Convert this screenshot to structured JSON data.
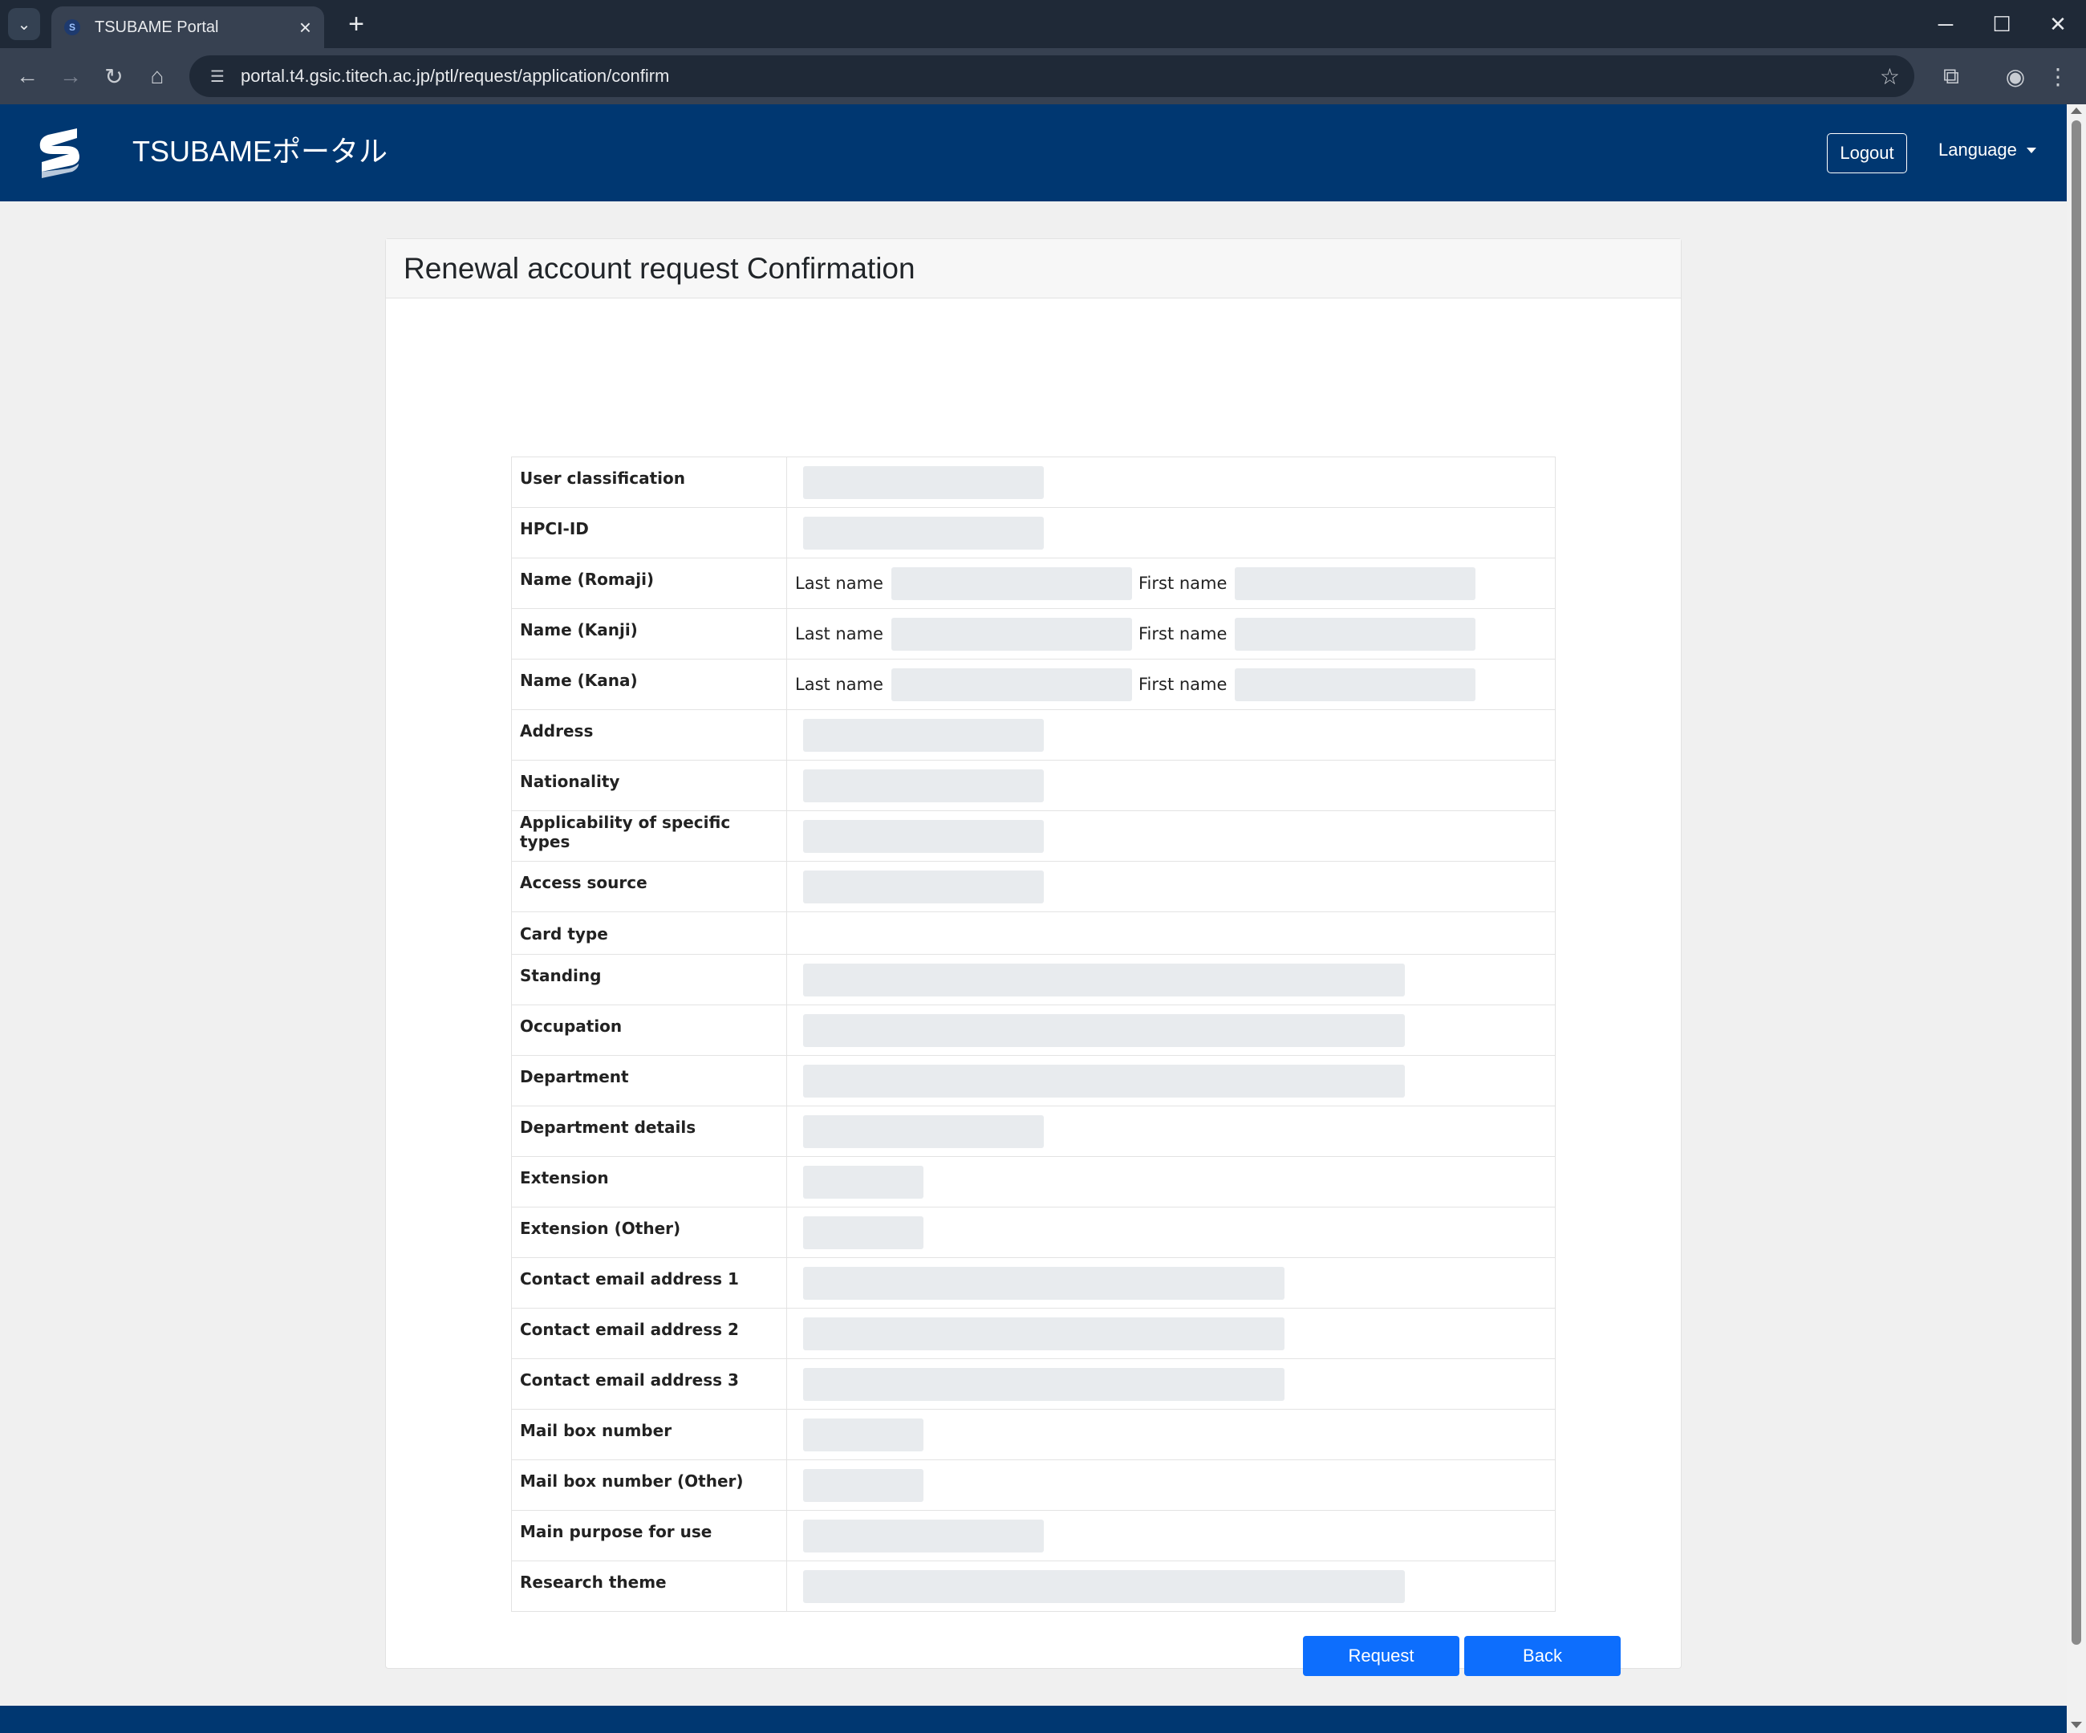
{
  "browser": {
    "tab_title": "TSUBAME Portal",
    "url": "portal.t4.gsic.titech.ac.jp/ptl/request/application/confirm"
  },
  "header": {
    "brand": "TSUBAMEポータル",
    "logout_label": "Logout",
    "language_label": "Language"
  },
  "colors": {
    "header_bg": "#003771",
    "button_primary": "#0d6efd",
    "field_bg": "#e8ebee"
  },
  "card": {
    "title": "Renewal account request Confirmation"
  },
  "form": {
    "user_classification": "User classification",
    "hpci_id": "HPCI-ID",
    "name_romaji": "Name (Romaji)",
    "name_kanji": "Name (Kanji)",
    "name_kana": "Name (Kana)",
    "last_name": "Last name",
    "first_name": "First name",
    "address": "Address",
    "nationality": "Nationality",
    "applicability": "Applicability of specific types",
    "access_source": "Access source",
    "card_type": "Card type",
    "standing": "Standing",
    "occupation": "Occupation",
    "department": "Department",
    "department_details": "Department details",
    "extension": "Extension",
    "extension_other": "Extension (Other)",
    "email1": "Contact email address 1",
    "email2": "Contact email address 2",
    "email3": "Contact email address 3",
    "mailbox": "Mail box number",
    "mailbox_other": "Mail box number (Other)",
    "main_purpose": "Main purpose for use",
    "research_theme": "Research theme"
  },
  "actions": {
    "request_label": "Request",
    "back_label": "Back"
  }
}
